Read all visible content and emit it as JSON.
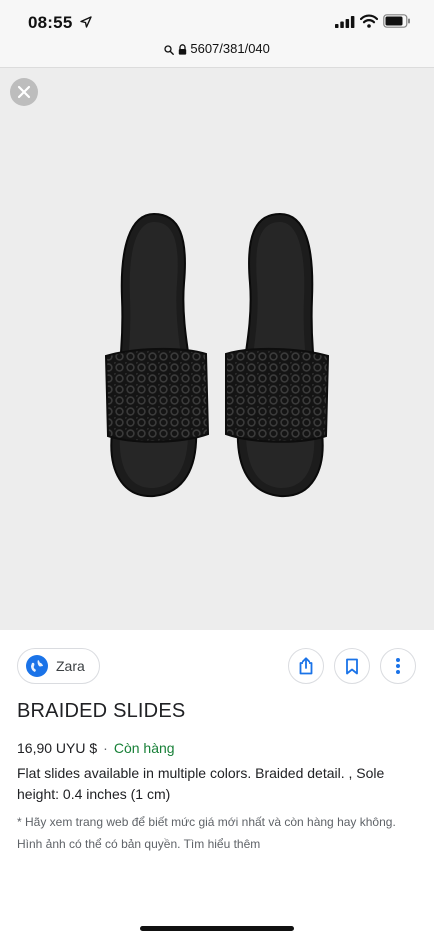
{
  "status_bar": {
    "time": "08:55"
  },
  "browser": {
    "url": "5607/381/040"
  },
  "viewer": {
    "close_icon": "close-icon"
  },
  "product": {
    "source": "Zara",
    "title": "BRAIDED SLIDES",
    "price": "16,90 UYU $",
    "price_separator": "·",
    "stock": "Còn hàng",
    "description": "Flat slides available in multiple colors. Braided detail. , Sole height: 0.4 inches (1 cm)",
    "note": "* Hãy xem trang web để biết mức giá mới nhất và còn hàng hay không. Hình ảnh có thể có bản quyền. Tìm hiểu thêm"
  },
  "colors": {
    "stock": "#188038",
    "viewer_bg": "#ededed",
    "globe": "#1a73e8"
  }
}
